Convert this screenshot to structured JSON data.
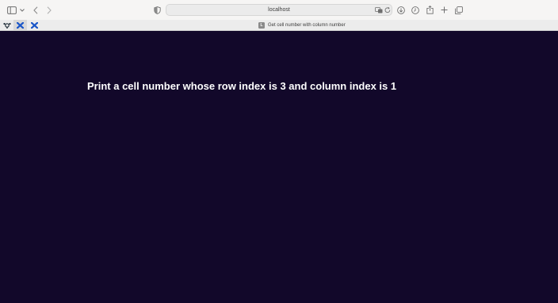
{
  "browser": {
    "address": "localhost",
    "tab": {
      "title": "Get cell number with column number",
      "favicon_letter": "L"
    },
    "pinned_tabs": [
      {
        "icon": "ubuntu-like-icon"
      },
      {
        "icon": "cross-blue-icon"
      },
      {
        "icon": "cross-blue-icon"
      }
    ]
  },
  "page": {
    "heading": "Print a cell number whose row index is 3 and column index is 1"
  },
  "colors": {
    "page_background": "#12082a",
    "heading": "#ffffff",
    "toolbar": "#f6f5f4",
    "pinned_icon_blue": "#1a56c8"
  }
}
